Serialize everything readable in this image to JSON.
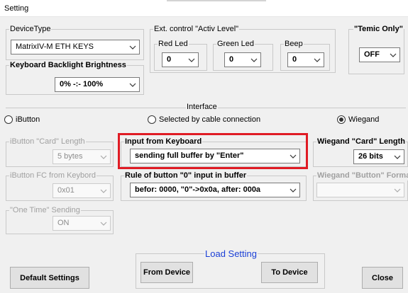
{
  "window": {
    "title": "Setting"
  },
  "device_type": {
    "legend": "DeviceType",
    "value": "MatrixIV-M ETH KEYS"
  },
  "ext_control": {
    "legend": "Ext. control  \"Activ Level\"",
    "red_led": {
      "legend": "Red Led",
      "value": "0"
    },
    "green_led": {
      "legend": "Green Led",
      "value": "0"
    },
    "beep": {
      "legend": "Beep",
      "value": "0"
    }
  },
  "temic": {
    "legend": "\"Temic Only\"",
    "value": "OFF"
  },
  "backlight": {
    "legend": "Keyboard Backlight Brightness",
    "value": "0% -:- 100%"
  },
  "interface": {
    "legend": "Interface",
    "options": [
      {
        "label": "iButton",
        "selected": false
      },
      {
        "label": "Selected by cable connection",
        "selected": false
      },
      {
        "label": "Wiegand",
        "selected": true
      }
    ]
  },
  "ibutton_card_length": {
    "legend": "iButton \"Card\" Length",
    "value": "5 bytes"
  },
  "ibutton_fc": {
    "legend": "iButton FC from Keybord",
    "value": "0x01"
  },
  "one_time": {
    "legend": "\"One Time\" Sending",
    "value": "ON"
  },
  "input_keyboard": {
    "legend": "Input from Keyboard",
    "value": "sending full buffer by \"Enter\""
  },
  "rule_button0": {
    "legend": "Rule of button \"0\" input in buffer",
    "value": "befor: 0000, \"0\"->0x0a, after: 000a"
  },
  "wiegand_card_length": {
    "legend": "Wiegand \"Card\" Length",
    "value": "26 bits"
  },
  "wiegand_button_format": {
    "legend": "Wiegand \"Button\" Format",
    "value": ""
  },
  "load_setting": {
    "legend": "Load Setting",
    "from_device": "From Device",
    "to_device": "To Device"
  },
  "buttons": {
    "default_settings": "Default Settings",
    "close": "Close"
  },
  "colors": {
    "highlight": "#e01b24",
    "load_setting_legend": "#1a3fd6"
  }
}
